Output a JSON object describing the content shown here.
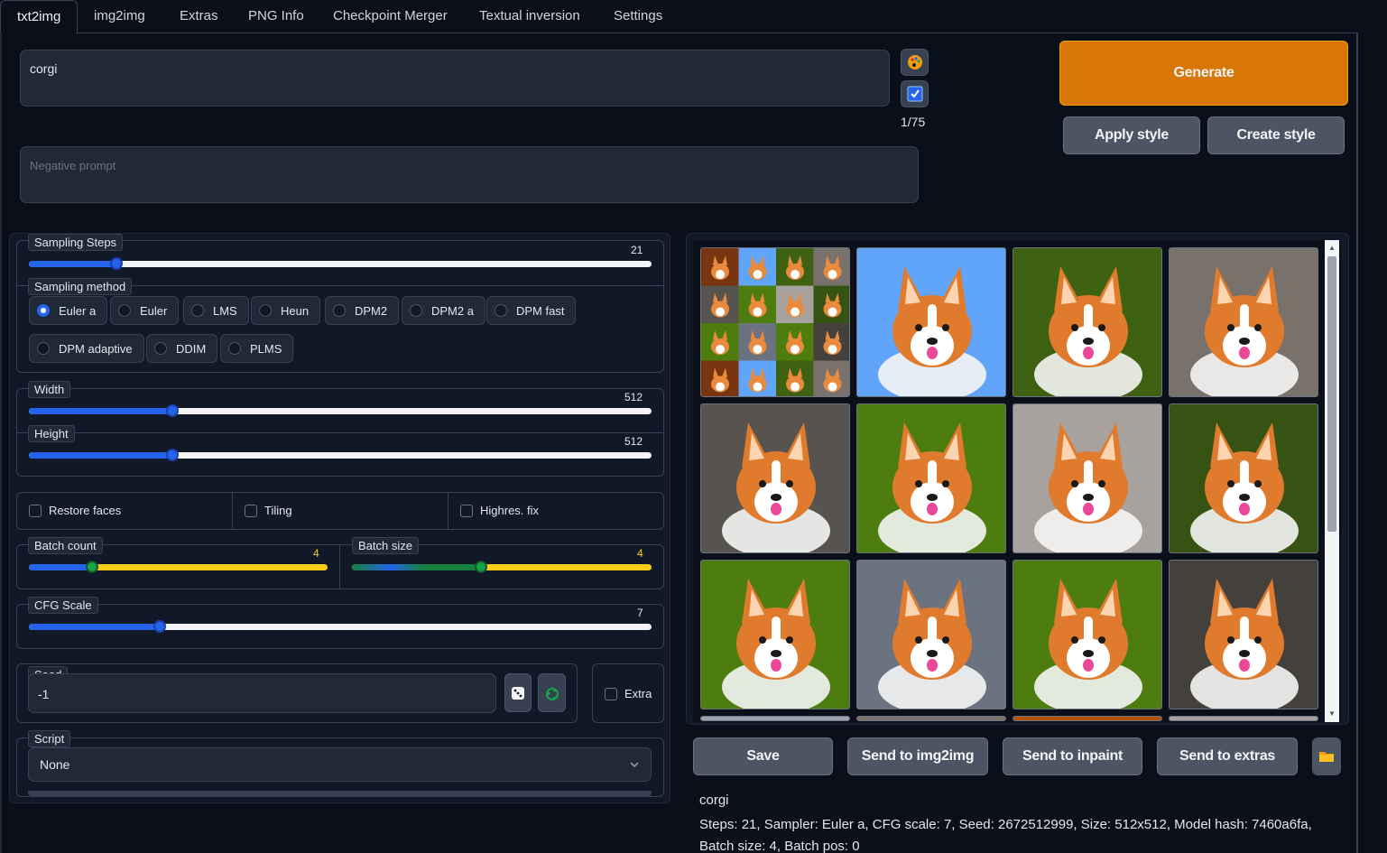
{
  "tabs": [
    "txt2img",
    "img2img",
    "Extras",
    "PNG Info",
    "Checkpoint Merger",
    "Textual inversion",
    "Settings"
  ],
  "prompt": {
    "value": "corgi",
    "token_count": "1/75",
    "negative_placeholder": "Negative prompt"
  },
  "buttons": {
    "generate": "Generate",
    "apply_style": "Apply style",
    "create_style": "Create style",
    "save": "Save",
    "send_img2img": "Send to img2img",
    "send_inpaint": "Send to inpaint",
    "send_extras": "Send to extras"
  },
  "sampling_steps": {
    "label": "Sampling Steps",
    "value": "21",
    "fraction": 0.14
  },
  "sampling_method": {
    "label": "Sampling method",
    "options": [
      "Euler a",
      "Euler",
      "LMS",
      "Heun",
      "DPM2",
      "DPM2 a",
      "DPM fast",
      "DPM adaptive",
      "DDIM",
      "PLMS"
    ],
    "selected": "Euler a"
  },
  "width": {
    "label": "Width",
    "value": "512",
    "fraction": 0.23
  },
  "height": {
    "label": "Height",
    "value": "512",
    "fraction": 0.23
  },
  "checkboxes": {
    "restore_faces": "Restore faces",
    "tiling": "Tiling",
    "highres_fix": "Highres. fix"
  },
  "batch_count": {
    "label": "Batch count",
    "value": "4",
    "fraction": 0.21
  },
  "batch_size": {
    "label": "Batch size",
    "value": "4",
    "fraction": 0.43
  },
  "cfg_scale": {
    "label": "CFG Scale",
    "value": "7",
    "fraction": 0.21
  },
  "seed": {
    "label": "Seed",
    "value": "-1",
    "extra_label": "Extra"
  },
  "script": {
    "label": "Script",
    "value": "None"
  },
  "gallery": {
    "tiles": [
      "grid",
      "corgi",
      "corgi",
      "corgi",
      "corgi",
      "corgi",
      "corgi",
      "corgi",
      "corgi",
      "corgi",
      "corgi",
      "corgi"
    ]
  },
  "info": {
    "prompt": "corgi",
    "params": "Steps: 21, Sampler: Euler a, CFG scale: 7, Seed: 2672512999, Size: 512x512, Model hash: 7460a6fa, Batch size: 4, Batch pos: 0"
  },
  "colors": {
    "generate": "#d97706",
    "accent": "#2563eb",
    "bg": "#0b0f19"
  },
  "icons": [
    "palette-icon",
    "checkbox-icon",
    "dice-icon",
    "recycle-icon",
    "folder-icon",
    "chevron-down-icon"
  ]
}
